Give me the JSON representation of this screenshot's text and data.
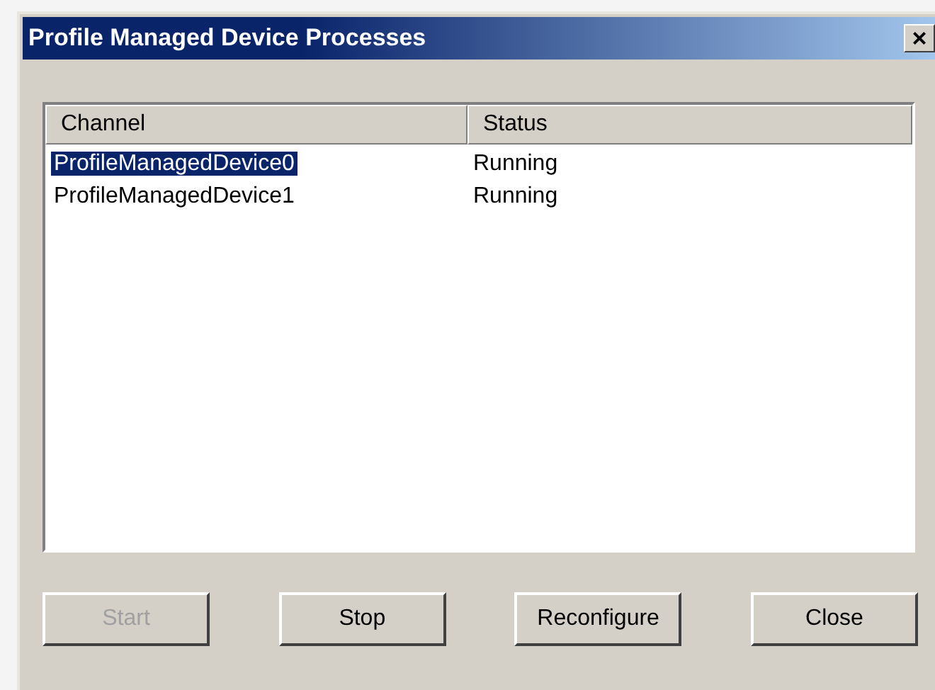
{
  "window": {
    "title": "Profile Managed Device Processes",
    "close": "×"
  },
  "table": {
    "columns": [
      "Channel",
      "Status"
    ],
    "rows": [
      {
        "channel": "ProfileManagedDevice0",
        "status": "Running",
        "selected": true
      },
      {
        "channel": "ProfileManagedDevice1",
        "status": "Running",
        "selected": false
      }
    ]
  },
  "buttons": [
    {
      "label": "Start",
      "disabled": true
    },
    {
      "label": "Stop",
      "disabled": false
    },
    {
      "label": "Reconfigure",
      "disabled": false
    },
    {
      "label": "Close",
      "disabled": false
    }
  ]
}
